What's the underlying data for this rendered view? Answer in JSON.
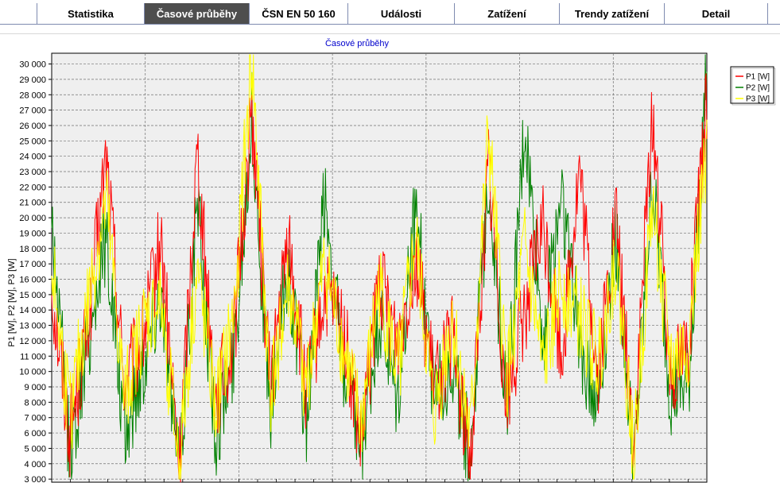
{
  "tabs": [
    {
      "label": "Statistika",
      "active": false
    },
    {
      "label": "Časové průběhy",
      "active": true
    },
    {
      "label": "ČSN EN 50 160",
      "active": false
    },
    {
      "label": "Události",
      "active": false
    },
    {
      "label": "Zatížení",
      "active": false
    },
    {
      "label": "Trendy zatížení",
      "active": false
    },
    {
      "label": "Detail",
      "active": false
    }
  ],
  "chart_data": {
    "type": "line",
    "title": "Časové průběhy",
    "ylabel": "P1 [W], P2 [W], P3 [W]",
    "xlabel": "",
    "ylim": [
      2800,
      30700
    ],
    "yticks": [
      3000,
      4000,
      5000,
      6000,
      7000,
      8000,
      9000,
      10000,
      11000,
      12000,
      13000,
      14000,
      15000,
      16000,
      17000,
      18000,
      19000,
      20000,
      21000,
      22000,
      23000,
      24000,
      25000,
      26000,
      27000,
      28000,
      29000,
      30000
    ],
    "ytick_labels": [
      "3 000",
      "4 000",
      "5 000",
      "6 000",
      "7 000",
      "8 000",
      "9 000",
      "10 000",
      "11 000",
      "12 000",
      "13 000",
      "14 000",
      "15 000",
      "16 000",
      "17 000",
      "18 000",
      "19 000",
      "20 000",
      "21 000",
      "22 000",
      "23 000",
      "24 000",
      "25 000",
      "26 000",
      "27 000",
      "28 000",
      "29 000",
      "30 000"
    ],
    "grid": true,
    "legend_position": "top-right",
    "x_samples": 37,
    "series": [
      {
        "name": "P1 [W]",
        "color": "#ff0000",
        "values": [
          15500,
          6000,
          13000,
          24000,
          9000,
          12000,
          18500,
          3500,
          24500,
          8000,
          12000,
          27000,
          9000,
          18500,
          8500,
          15000,
          13000,
          5000,
          16000,
          12000,
          17500,
          9000,
          12000,
          4000,
          23500,
          8000,
          14000,
          19500,
          11000,
          23000,
          9500,
          20000,
          5000,
          27000,
          10000,
          12000,
          27500
        ]
      },
      {
        "name": "P2 [W]",
        "color": "#008000",
        "values": [
          20000,
          4500,
          12000,
          19000,
          5500,
          10500,
          15500,
          3000,
          21000,
          6000,
          11000,
          26500,
          7000,
          17000,
          6500,
          21500,
          10000,
          4500,
          13500,
          7500,
          21000,
          8500,
          10500,
          4500,
          23000,
          7500,
          26000,
          12000,
          22000,
          12000,
          8000,
          19000,
          3500,
          22500,
          8500,
          9000,
          30000
        ]
      },
      {
        "name": "P3 [W]",
        "color": "#ffff00",
        "values": [
          17000,
          7000,
          14500,
          21000,
          8000,
          13000,
          14500,
          4000,
          16500,
          7500,
          13500,
          30500,
          8500,
          15500,
          9000,
          17000,
          11500,
          6500,
          15500,
          10000,
          18500,
          7000,
          13500,
          5500,
          25500,
          9500,
          18000,
          10000,
          16000,
          13500,
          10500,
          17500,
          4500,
          21000,
          10500,
          11500,
          25000
        ]
      }
    ]
  }
}
